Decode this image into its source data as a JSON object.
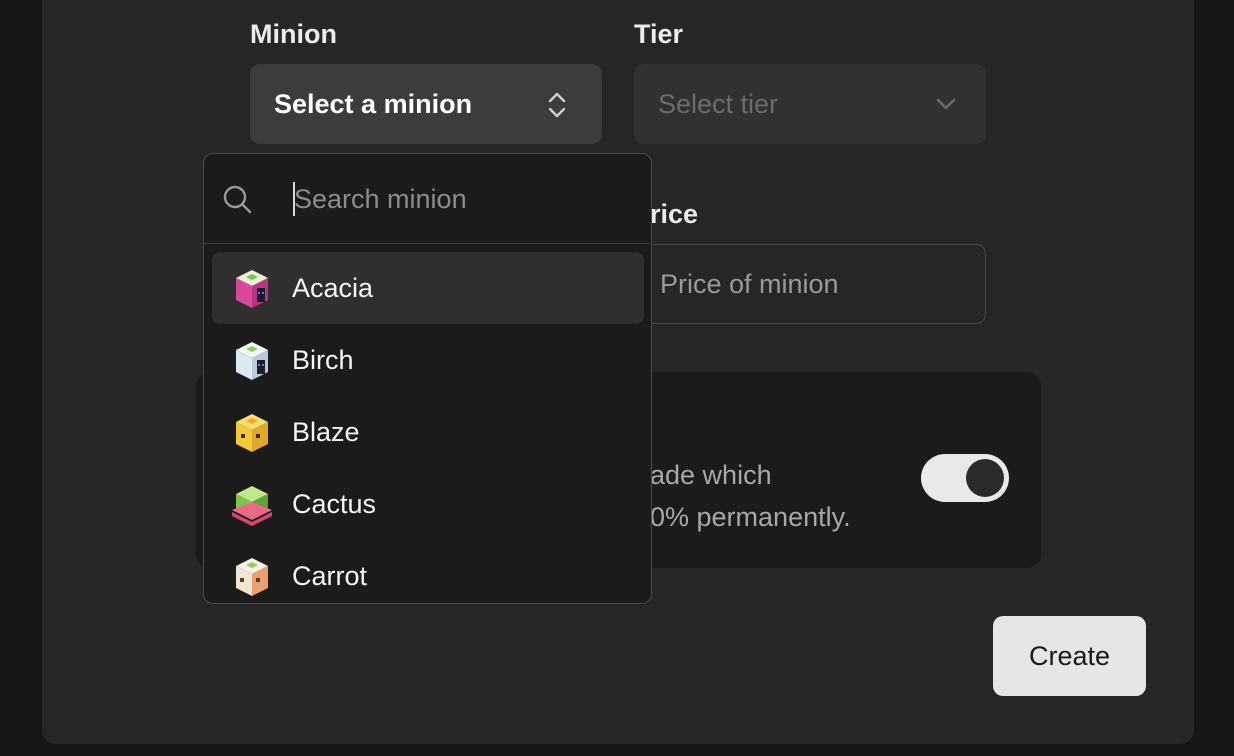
{
  "form": {
    "minion_label": "Minion",
    "minion_select_value": "Select a minion",
    "tier_label": "Tier",
    "tier_placeholder": "Select tier",
    "price_label": "rice",
    "price_placeholder": "Price of minion",
    "upgrade_line1": "ade which",
    "upgrade_line2": "0% permanently.",
    "upgrade_toggle_on": true,
    "create_label": "Create"
  },
  "dropdown": {
    "search_placeholder": "Search minion",
    "items": [
      {
        "label": "Acacia",
        "icon": "acacia-minion-icon",
        "color": "#d9479b",
        "active": true
      },
      {
        "label": "Birch",
        "icon": "birch-minion-icon",
        "color": "#dce9f2",
        "active": false
      },
      {
        "label": "Blaze",
        "icon": "blaze-minion-icon",
        "color": "#f3c93a",
        "active": false
      },
      {
        "label": "Cactus",
        "icon": "cactus-minion-icon",
        "color": "#7fc44a",
        "active": false
      },
      {
        "label": "Carrot",
        "icon": "carrot-minion-icon",
        "color": "#f0e6d6",
        "active": false
      }
    ]
  },
  "colors": {
    "background": "#161616",
    "card": "#262626",
    "select": "#3c3c3c",
    "dropdown": "#1b1b1b",
    "button": "#e6e6e6"
  }
}
